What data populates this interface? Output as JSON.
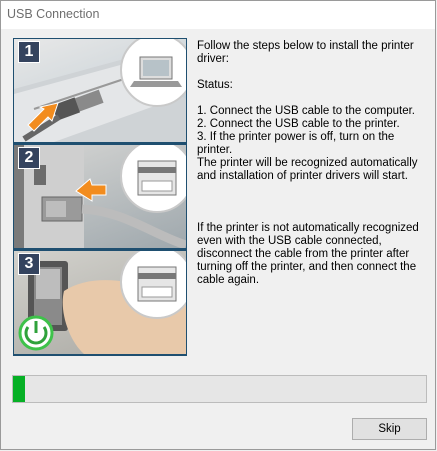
{
  "window": {
    "title": "USB Connection"
  },
  "steps": [
    {
      "number": "1"
    },
    {
      "number": "2"
    },
    {
      "number": "3"
    }
  ],
  "instructions": {
    "intro": "Follow the steps below to install the printer driver:",
    "status_label": "Status:",
    "step1": "1. Connect the USB cable to the computer.",
    "step2": "2. Connect the USB cable to the printer.",
    "step3": "3. If the printer power is off, turn on the printer.",
    "recognized": "The printer will be recognized automatically and installation of printer drivers will start.",
    "note": "If the printer is not automatically recognized even with the USB cable connected, disconnect the cable from the printer after turning off the printer, and then connect the cable again."
  },
  "progress": {
    "value": 0.03,
    "color": "#06b025"
  },
  "buttons": {
    "skip": "Skip"
  }
}
